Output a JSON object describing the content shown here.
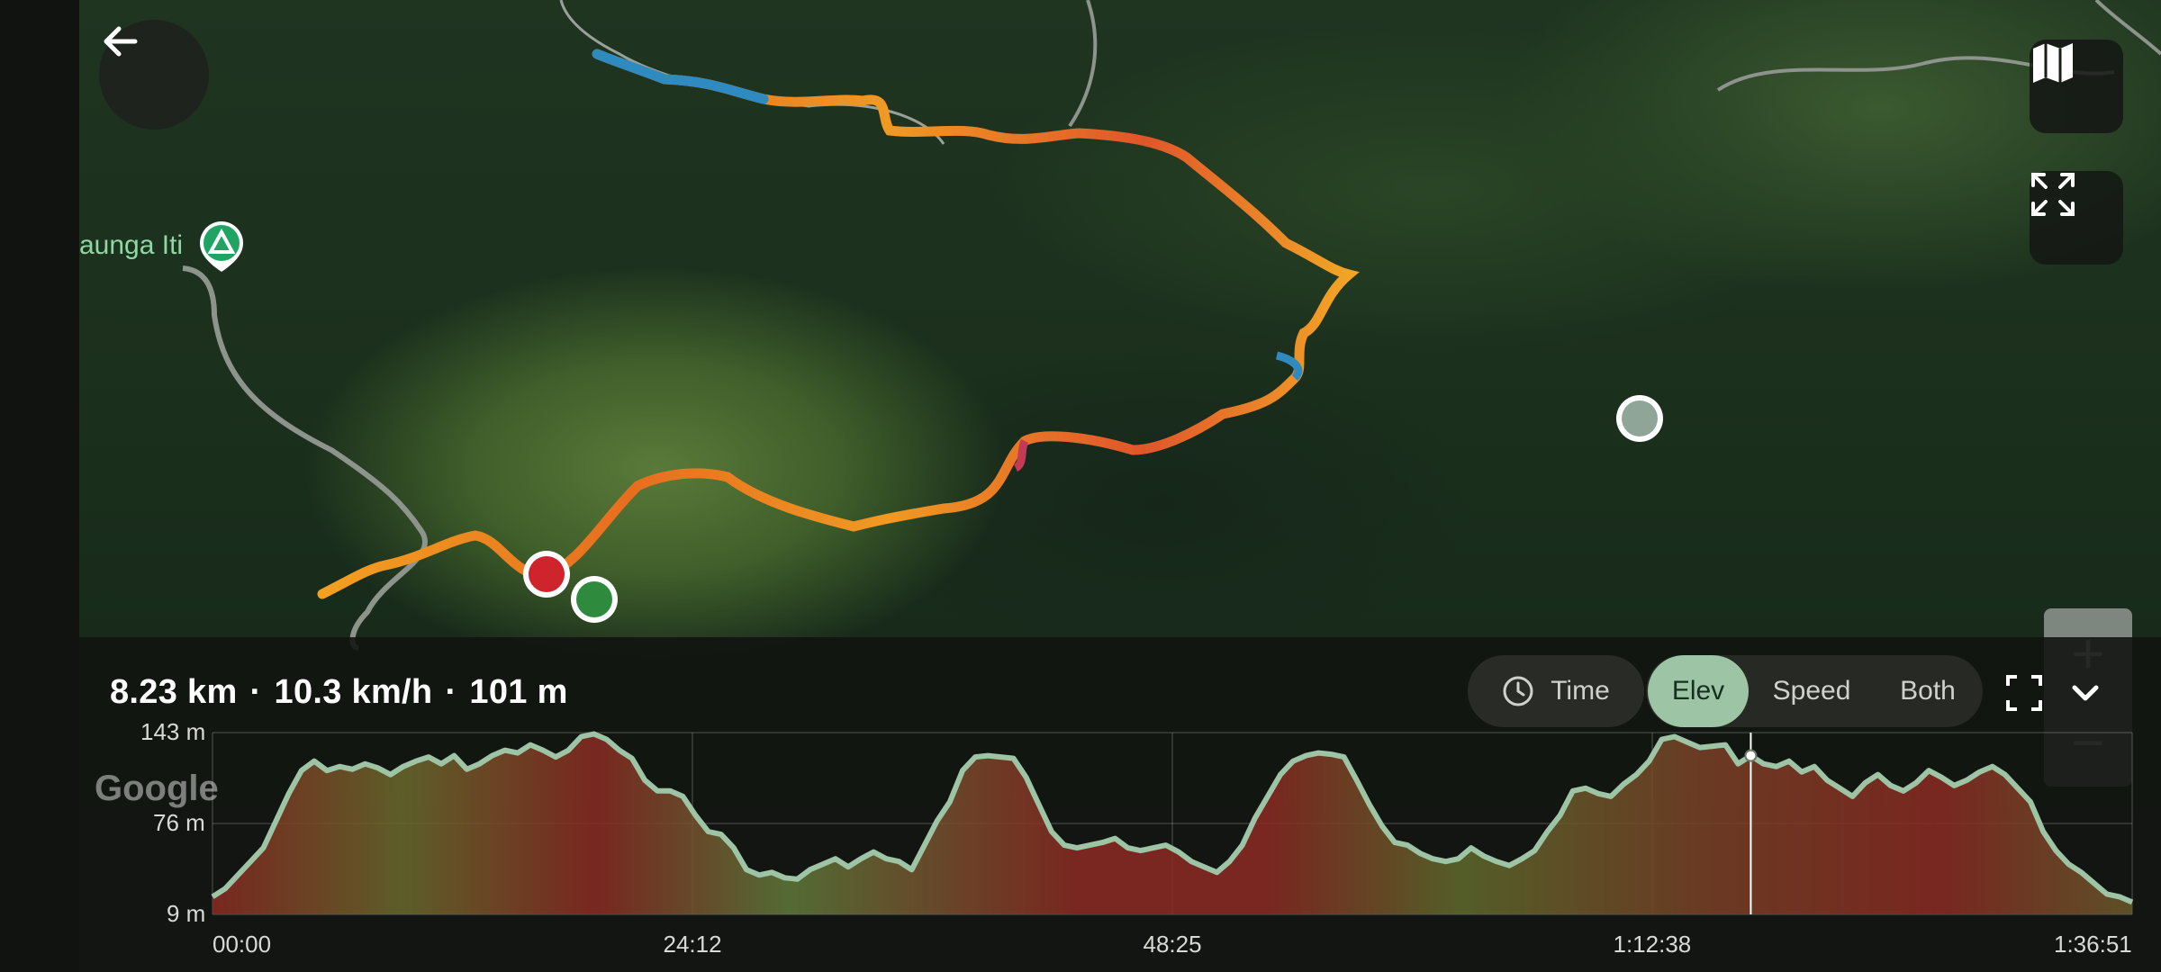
{
  "map": {
    "poi_label": "aunga Iti",
    "attribution": "Google"
  },
  "stats": {
    "distance": "8.23 km",
    "speed": "10.3 km/h",
    "elevation": "101 m",
    "separator": "·"
  },
  "controls": {
    "time_label": "Time",
    "modes": [
      "Elev",
      "Speed",
      "Both"
    ],
    "active_mode": "Elev"
  },
  "icons": {
    "back": "arrow-left-icon",
    "map_layers": "map-icon",
    "fullscreen_map": "expand-icon",
    "clock": "clock-icon",
    "fullscreen_chart": "fullscreen-icon",
    "collapse": "chevron-down-icon",
    "campsite": "campsite-icon"
  },
  "colors": {
    "accent": "#9dc4a4",
    "start_marker": "#2e8b3e",
    "end_marker": "#d0242c",
    "current_marker": "#8ea597"
  },
  "chart_data": {
    "type": "area",
    "y_ticks": [
      "143 m",
      "76 m",
      "9 m"
    ],
    "ylim": [
      9,
      143
    ],
    "x_ticks": [
      "00:00",
      "24:12",
      "48:25",
      "1:12:38",
      "1:36:51"
    ],
    "xlim_seconds": [
      0,
      5811
    ],
    "series": [
      {
        "values": [
          22,
          28,
          38,
          48,
          58,
          78,
          98,
          115,
          122,
          115,
          118,
          116,
          120,
          117,
          112,
          118,
          122,
          125,
          120,
          126,
          116,
          120,
          126,
          130,
          128,
          134,
          130,
          125,
          130,
          140,
          142,
          138,
          130,
          124,
          108,
          100,
          100,
          96,
          82,
          70,
          68,
          58,
          42,
          38,
          40,
          36,
          35,
          42,
          46,
          50,
          44,
          50,
          55,
          50,
          48,
          42,
          60,
          78,
          92,
          115,
          125,
          126,
          125,
          124,
          110,
          90,
          70,
          60,
          58,
          60,
          62,
          65,
          58,
          56,
          58,
          60,
          55,
          48,
          44,
          40,
          48,
          60,
          80,
          96,
          112,
          122,
          126,
          128,
          127,
          125,
          108,
          90,
          74,
          62,
          60,
          54,
          50,
          48,
          50,
          58,
          52,
          48,
          45,
          50,
          56,
          70,
          82,
          100,
          102,
          98,
          96,
          105,
          112,
          122,
          138,
          140,
          136,
          132,
          133,
          134,
          120,
          126,
          120,
          118,
          122,
          114,
          118,
          108,
          102,
          96,
          106,
          112,
          104,
          100,
          106,
          115,
          110,
          104,
          108,
          114,
          118,
          112,
          102,
          92,
          70,
          56,
          46,
          40,
          32,
          24,
          22,
          18
        ]
      }
    ]
  }
}
